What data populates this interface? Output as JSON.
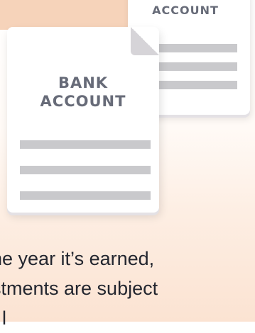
{
  "back_document": {
    "title": "ACCOUNT"
  },
  "front_document": {
    "title_line1": "BANK",
    "title_line2": "ACCOUNT"
  },
  "body_text": {
    "line1": "he year it’s earned,",
    "line2": "stments are subject",
    "line3": "f l"
  }
}
